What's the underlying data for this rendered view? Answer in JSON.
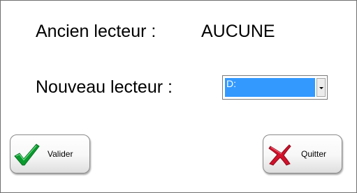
{
  "dialog": {
    "old_drive_label": "Ancien lecteur :",
    "old_drive_value": "AUCUNE",
    "new_drive_label": "Nouveau lecteur :",
    "new_drive_selected": "D:",
    "validate_label": "Valider",
    "quit_label": "Quitter"
  },
  "icons": {
    "validate": "checkmark-icon",
    "quit": "red-x-icon",
    "dropdown": "chevron-down-icon"
  },
  "colors": {
    "selection_highlight": "#3399ff",
    "check_green": "#0a9a2e",
    "cross_red": "#d3102a"
  }
}
